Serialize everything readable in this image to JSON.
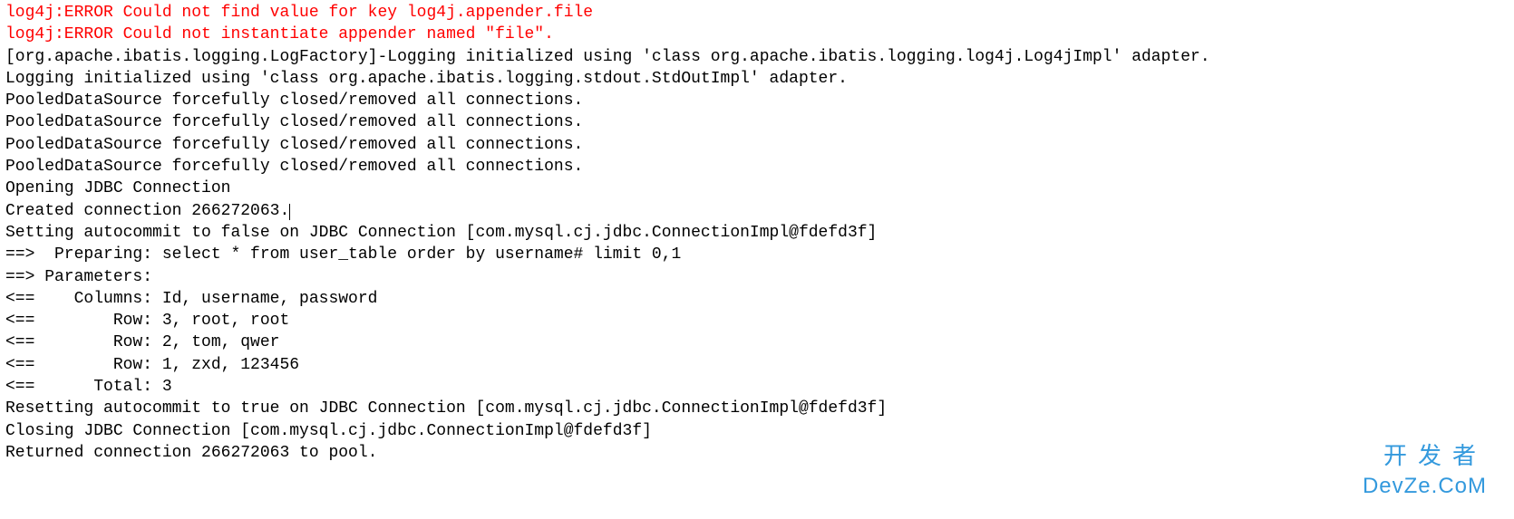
{
  "console": {
    "lines": [
      {
        "type": "error",
        "text": "log4j:ERROR Could not find value for key log4j.appender.file"
      },
      {
        "type": "error",
        "text": "log4j:ERROR Could not instantiate appender named \"file\"."
      },
      {
        "type": "normal",
        "text": "[org.apache.ibatis.logging.LogFactory]-Logging initialized using 'class org.apache.ibatis.logging.log4j.Log4jImpl' adapter."
      },
      {
        "type": "normal",
        "text": "Logging initialized using 'class org.apache.ibatis.logging.stdout.StdOutImpl' adapter."
      },
      {
        "type": "normal",
        "text": "PooledDataSource forcefully closed/removed all connections."
      },
      {
        "type": "normal",
        "text": "PooledDataSource forcefully closed/removed all connections."
      },
      {
        "type": "normal",
        "text": "PooledDataSource forcefully closed/removed all connections."
      },
      {
        "type": "normal",
        "text": "PooledDataSource forcefully closed/removed all connections."
      },
      {
        "type": "normal",
        "text": "Opening JDBC Connection"
      },
      {
        "type": "normal",
        "text": "Created connection 266272063."
      },
      {
        "type": "normal",
        "text": "Setting autocommit to false on JDBC Connection [com.mysql.cj.jdbc.ConnectionImpl@fdefd3f]"
      },
      {
        "type": "normal",
        "text": "==>  Preparing: select * from user_table order by username# limit 0,1"
      },
      {
        "type": "normal",
        "text": "==> Parameters:"
      },
      {
        "type": "normal",
        "text": "<==    Columns: Id, username, password"
      },
      {
        "type": "normal",
        "text": "<==        Row: 3, root, root"
      },
      {
        "type": "normal",
        "text": "<==        Row: 2, tom, qwer"
      },
      {
        "type": "normal",
        "text": "<==        Row: 1, zxd, 123456"
      },
      {
        "type": "normal",
        "text": "<==      Total: 3"
      },
      {
        "type": "normal",
        "text": "Resetting autocommit to true on JDBC Connection [com.mysql.cj.jdbc.ConnectionImpl@fdefd3f]"
      },
      {
        "type": "normal",
        "text": "Closing JDBC Connection [com.mysql.cj.jdbc.ConnectionImpl@fdefd3f]"
      },
      {
        "type": "normal",
        "text": "Returned connection 266272063 to pool."
      }
    ]
  },
  "watermark": {
    "top": "开发者",
    "bottom": "DevZe.CoM"
  }
}
